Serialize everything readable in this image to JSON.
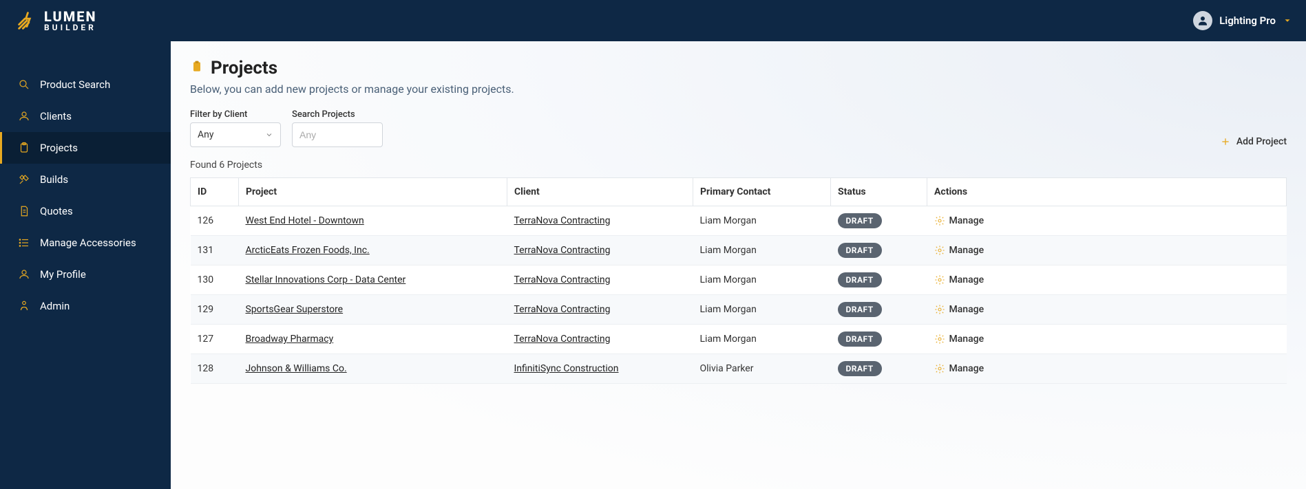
{
  "brand": {
    "line1": "LUMEN",
    "line2": "BUILDER"
  },
  "user": {
    "name": "Lighting Pro"
  },
  "sidebar": {
    "items": [
      {
        "label": "Product Search"
      },
      {
        "label": "Clients"
      },
      {
        "label": "Projects"
      },
      {
        "label": "Builds"
      },
      {
        "label": "Quotes"
      },
      {
        "label": "Manage Accessories"
      },
      {
        "label": "My Profile"
      },
      {
        "label": "Admin"
      }
    ]
  },
  "page": {
    "title": "Projects",
    "subtitle": "Below, you can add new projects or manage your existing projects."
  },
  "filters": {
    "client_label": "Filter by Client",
    "client_value": "Any",
    "search_label": "Search Projects",
    "search_placeholder": "Any"
  },
  "add_button": {
    "label": "Add Project"
  },
  "results": {
    "found_text": "Found 6 Projects"
  },
  "table": {
    "headers": {
      "id": "ID",
      "project": "Project",
      "client": "Client",
      "contact": "Primary Contact",
      "status": "Status",
      "actions": "Actions"
    },
    "manage_label": "Manage",
    "rows": [
      {
        "id": "126",
        "project": "West End Hotel - Downtown",
        "client": "TerraNova Contracting",
        "contact": "Liam Morgan",
        "status": "DRAFT"
      },
      {
        "id": "131",
        "project": "ArcticEats Frozen Foods, Inc.",
        "client": "TerraNova Contracting",
        "contact": "Liam Morgan",
        "status": "DRAFT"
      },
      {
        "id": "130",
        "project": "Stellar Innovations Corp - Data Center",
        "client": "TerraNova Contracting",
        "contact": "Liam Morgan",
        "status": "DRAFT"
      },
      {
        "id": "129",
        "project": "SportsGear Superstore",
        "client": "TerraNova Contracting",
        "contact": "Liam Morgan",
        "status": "DRAFT"
      },
      {
        "id": "127",
        "project": "Broadway Pharmacy",
        "client": "TerraNova Contracting",
        "contact": "Liam Morgan",
        "status": "DRAFT"
      },
      {
        "id": "128",
        "project": "Johnson & Williams Co.",
        "client": "InfinitiSync Construction",
        "contact": "Olivia Parker",
        "status": "DRAFT"
      }
    ]
  }
}
